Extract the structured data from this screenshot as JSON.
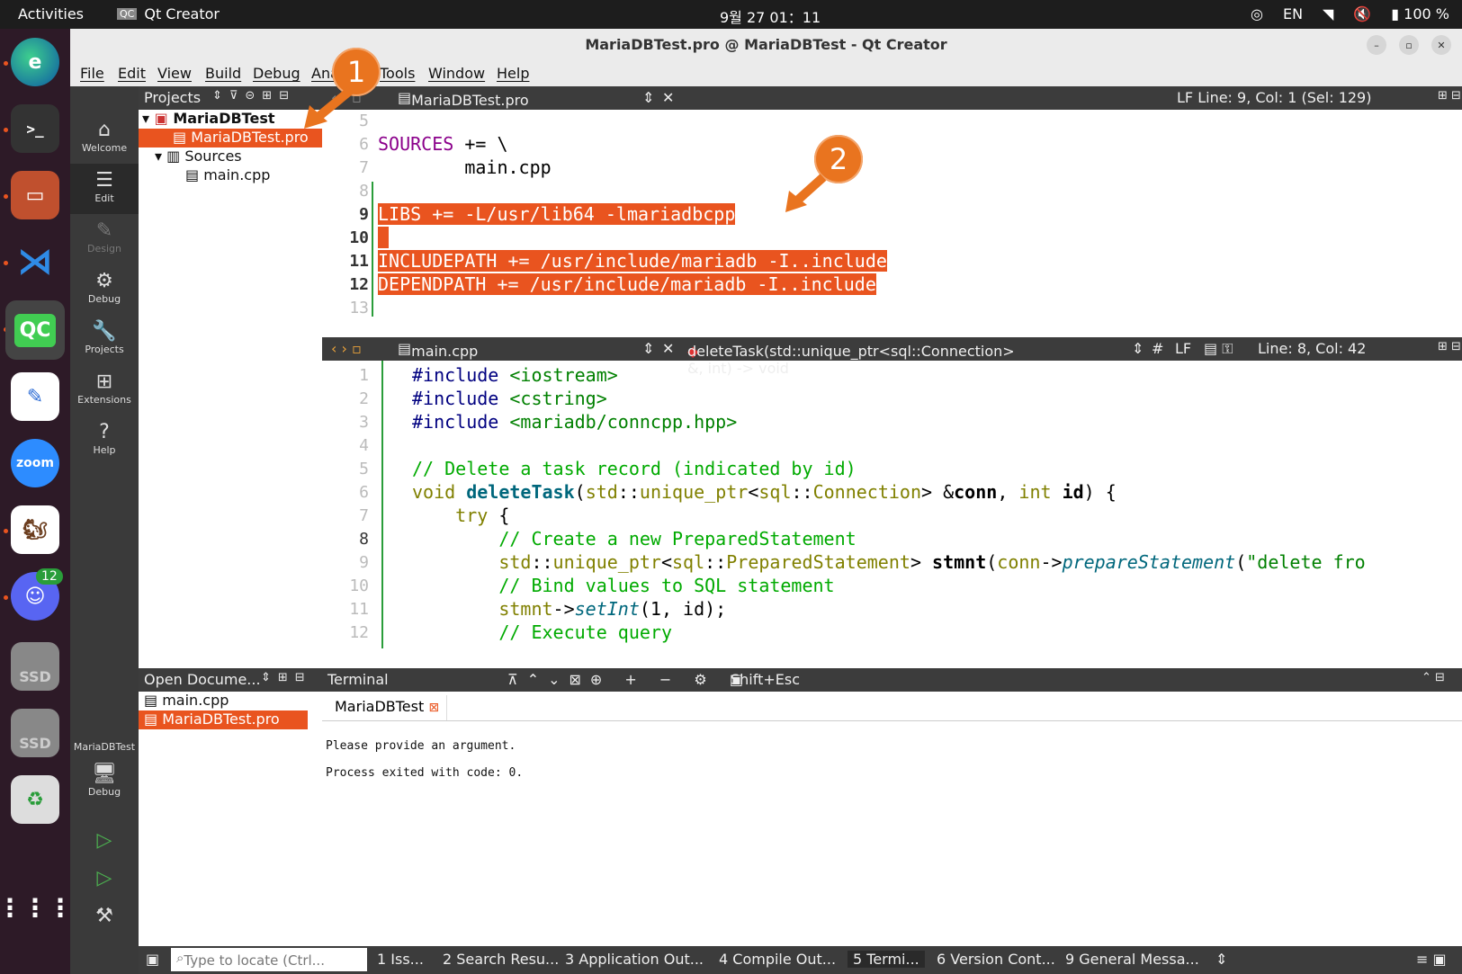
{
  "topbar": {
    "activities": "Activities",
    "app_name": "Qt Creator",
    "clock": "9월 27  01：11",
    "lang": "EN",
    "battery": "100 %"
  },
  "dock": {
    "badge": "12",
    "items": [
      "edge",
      "terminal",
      "files",
      "vscode",
      "qt-creator",
      "text-editor",
      "zoom",
      "scrapbook",
      "discord",
      "ssd",
      "ssd",
      "trash",
      "apps"
    ],
    "zoom_label": "zoom",
    "ssd_label": "SSD"
  },
  "window": {
    "title": "MariaDBTest.pro @ MariaDBTest - Qt Creator"
  },
  "menu": [
    "File",
    "Edit",
    "View",
    "Build",
    "Debug",
    "Ana",
    "Tools",
    "Window",
    "Help"
  ],
  "modes": [
    {
      "label": "Welcome",
      "icon": "⌂"
    },
    {
      "label": "Edit",
      "icon": "☰"
    },
    {
      "label": "Design",
      "icon": "✎"
    },
    {
      "label": "Debug",
      "icon": "⚙"
    },
    {
      "label": "Projects",
      "icon": "🔧"
    },
    {
      "label": "Extensions",
      "icon": "⊞"
    },
    {
      "label": "Help",
      "icon": "?"
    }
  ],
  "kit": {
    "project": "MariaDBTest",
    "mode": "Debug"
  },
  "projects_panel": {
    "title": "Projects",
    "tree": [
      {
        "label": "MariaDBTest",
        "bold": true
      },
      {
        "label": "MariaDBTest.pro",
        "selected": true
      },
      {
        "label": "Sources"
      },
      {
        "label": "main.cpp"
      }
    ]
  },
  "open_docs": {
    "title": "Open Docume...",
    "items": [
      "main.cpp",
      "MariaDBTest.pro"
    ]
  },
  "editor1": {
    "file": "MariaDBTest.pro",
    "status": "LF   Line: 9, Col: 1 (Sel: 129)",
    "lines": [
      {
        "n": "5",
        "t": ""
      },
      {
        "n": "6",
        "t": "SOURCES += \\"
      },
      {
        "n": "7",
        "t": "        main.cpp"
      },
      {
        "n": "8",
        "t": ""
      },
      {
        "n": "9",
        "t": "LIBS += -L/usr/lib64 -lmariadbcpp"
      },
      {
        "n": "10",
        "t": " "
      },
      {
        "n": "11",
        "t": "INCLUDEPATH += /usr/include/mariadb -I..include"
      },
      {
        "n": "12",
        "t": "DEPENDPATH += /usr/include/mariadb -I..include"
      },
      {
        "n": "13",
        "t": ""
      }
    ]
  },
  "editor2": {
    "file": "main.cpp",
    "symbol": "deleteTask(std::unique_ptr<sql::Connection> &, int) -> void",
    "hash": "#",
    "lf": "LF",
    "pos": "Line: 8, Col: 42",
    "lines": [
      {
        "n": "1",
        "t": "#include <iostream>"
      },
      {
        "n": "2",
        "t": "#include <cstring>"
      },
      {
        "n": "3",
        "t": "#include <mariadb/conncpp.hpp>"
      },
      {
        "n": "4",
        "t": ""
      },
      {
        "n": "5",
        "t": "// Delete a task record (indicated by id)"
      },
      {
        "n": "6",
        "t": "void deleteTask(std::unique_ptr<sql::Connection> &conn, int id) {"
      },
      {
        "n": "7",
        "t": "    try {"
      },
      {
        "n": "8",
        "t": "        // Create a new PreparedStatement"
      },
      {
        "n": "9",
        "t": "        std::unique_ptr<sql::PreparedStatement> stmnt(conn->prepareStatement(\"delete fro"
      },
      {
        "n": "10",
        "t": "        // Bind values to SQL statement"
      },
      {
        "n": "11",
        "t": "        stmnt->setInt(1, id);"
      },
      {
        "n": "12",
        "t": "        // Execute query"
      }
    ]
  },
  "terminal": {
    "title": "Terminal",
    "shortcut": "Shift+Esc",
    "tab": "MariaDBTest",
    "output": [
      "Please provide an argument.",
      "Process exited with code: 0."
    ]
  },
  "statusbar": {
    "locate_placeholder": "Type to locate (Ctrl...",
    "panes": [
      "1  Iss...",
      "2  Search Resu...",
      "3  Application Out...",
      "4  Compile Out...",
      "5  Termi...",
      "6  Version Cont...",
      "9  General Messa..."
    ]
  },
  "callouts": [
    "1",
    "2"
  ],
  "colors": {
    "accent": "#e9541f",
    "callout": "#e9741f"
  }
}
